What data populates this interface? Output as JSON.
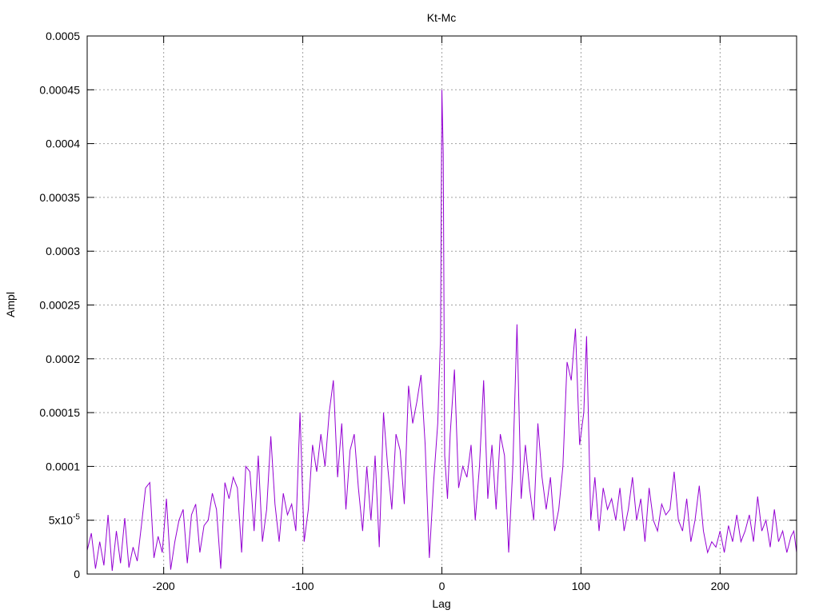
{
  "chart_data": {
    "type": "line",
    "title": "Kt-Mc",
    "xlabel": "Lag",
    "ylabel": "Ampl",
    "xlim": [
      -255,
      255
    ],
    "ylim": [
      0,
      0.0005
    ],
    "grid": true,
    "x_ticks": [
      {
        "value": -200,
        "label": "-200"
      },
      {
        "value": -100,
        "label": "-100"
      },
      {
        "value": 0,
        "label": "0"
      },
      {
        "value": 100,
        "label": "100"
      },
      {
        "value": 200,
        "label": "200"
      }
    ],
    "y_ticks": [
      {
        "value": 0,
        "label": "0"
      },
      {
        "value": 5e-05,
        "label": "5x10",
        "sup": "-5"
      },
      {
        "value": 0.0001,
        "label": "0.0001"
      },
      {
        "value": 0.00015,
        "label": "0.00015"
      },
      {
        "value": 0.0002,
        "label": "0.0002"
      },
      {
        "value": 0.00025,
        "label": "0.00025"
      },
      {
        "value": 0.0003,
        "label": "0.0003"
      },
      {
        "value": 0.00035,
        "label": "0.00035"
      },
      {
        "value": 0.0004,
        "label": "0.0004"
      },
      {
        "value": 0.00045,
        "label": "0.00045"
      },
      {
        "value": 0.0005,
        "label": "0.0005"
      }
    ],
    "series": [
      {
        "color": "#9400d3",
        "points": [
          [
            -255,
            2.2e-05
          ],
          [
            -252,
            3.8e-05
          ],
          [
            -249,
            5e-06
          ],
          [
            -246,
            3e-05
          ],
          [
            -243,
            8e-06
          ],
          [
            -240,
            5.5e-05
          ],
          [
            -237,
            3e-06
          ],
          [
            -234,
            4e-05
          ],
          [
            -231,
            1e-05
          ],
          [
            -228,
            5.2e-05
          ],
          [
            -225,
            6e-06
          ],
          [
            -222,
            2.5e-05
          ],
          [
            -219,
            1.2e-05
          ],
          [
            -216,
            4.5e-05
          ],
          [
            -213,
            8e-05
          ],
          [
            -210,
            8.5e-05
          ],
          [
            -207,
            1.5e-05
          ],
          [
            -204,
            3.5e-05
          ],
          [
            -201,
            2e-05
          ],
          [
            -198,
            7e-05
          ],
          [
            -195,
            4e-06
          ],
          [
            -192,
            3e-05
          ],
          [
            -189,
            5e-05
          ],
          [
            -186,
            6e-05
          ],
          [
            -183,
            1e-05
          ],
          [
            -180,
            5.5e-05
          ],
          [
            -177,
            6.5e-05
          ],
          [
            -174,
            2e-05
          ],
          [
            -171,
            4.5e-05
          ],
          [
            -168,
            5e-05
          ],
          [
            -165,
            7.5e-05
          ],
          [
            -162,
            6e-05
          ],
          [
            -159,
            5e-06
          ],
          [
            -156,
            8.5e-05
          ],
          [
            -153,
            7e-05
          ],
          [
            -150,
            9e-05
          ],
          [
            -147,
            8e-05
          ],
          [
            -144,
            2e-05
          ],
          [
            -141,
            0.0001
          ],
          [
            -138,
            9.5e-05
          ],
          [
            -135,
            4e-05
          ],
          [
            -132,
            0.00011
          ],
          [
            -129,
            3e-05
          ],
          [
            -126,
            6e-05
          ],
          [
            -123,
            0.000128
          ],
          [
            -120,
            6.5e-05
          ],
          [
            -117,
            3e-05
          ],
          [
            -114,
            7.5e-05
          ],
          [
            -111,
            5.5e-05
          ],
          [
            -108,
            6.5e-05
          ],
          [
            -105,
            4e-05
          ],
          [
            -102,
            0.00015
          ],
          [
            -99,
            3e-05
          ],
          [
            -96,
            6e-05
          ],
          [
            -93,
            0.00012
          ],
          [
            -90,
            9.5e-05
          ],
          [
            -87,
            0.00013
          ],
          [
            -84,
            0.0001
          ],
          [
            -81,
            0.00015
          ],
          [
            -78,
            0.00018
          ],
          [
            -75,
            9e-05
          ],
          [
            -72,
            0.00014
          ],
          [
            -69,
            6e-05
          ],
          [
            -66,
            0.000115
          ],
          [
            -63,
            0.00013
          ],
          [
            -60,
            8e-05
          ],
          [
            -57,
            4e-05
          ],
          [
            -54,
            0.0001
          ],
          [
            -51,
            5e-05
          ],
          [
            -48,
            0.00011
          ],
          [
            -45,
            2.5e-05
          ],
          [
            -42,
            0.00015
          ],
          [
            -39,
            0.0001
          ],
          [
            -36,
            6e-05
          ],
          [
            -33,
            0.00013
          ],
          [
            -30,
            0.000115
          ],
          [
            -27,
            6.5e-05
          ],
          [
            -24,
            0.000175
          ],
          [
            -21,
            0.00014
          ],
          [
            -18,
            0.00016
          ],
          [
            -15,
            0.000185
          ],
          [
            -12,
            0.00012
          ],
          [
            -9,
            1.5e-05
          ],
          [
            -6,
            8.5e-05
          ],
          [
            -3,
            0.00014
          ],
          [
            -1,
            0.00022
          ],
          [
            0,
            0.00045
          ],
          [
            1,
            0.00039
          ],
          [
            2,
            0.00011
          ],
          [
            4,
            7e-05
          ],
          [
            6,
            0.00013
          ],
          [
            9,
            0.00019
          ],
          [
            12,
            8e-05
          ],
          [
            15,
            0.0001
          ],
          [
            18,
            9e-05
          ],
          [
            21,
            0.00012
          ],
          [
            24,
            5e-05
          ],
          [
            27,
            0.0001
          ],
          [
            30,
            0.00018
          ],
          [
            33,
            7e-05
          ],
          [
            36,
            0.00012
          ],
          [
            39,
            6e-05
          ],
          [
            42,
            0.00013
          ],
          [
            45,
            0.00011
          ],
          [
            48,
            2e-05
          ],
          [
            51,
            0.0001
          ],
          [
            54,
            0.000232
          ],
          [
            57,
            7e-05
          ],
          [
            60,
            0.00012
          ],
          [
            63,
            8e-05
          ],
          [
            66,
            5e-05
          ],
          [
            69,
            0.00014
          ],
          [
            72,
            9e-05
          ],
          [
            75,
            6e-05
          ],
          [
            78,
            9e-05
          ],
          [
            81,
            4e-05
          ],
          [
            84,
            6e-05
          ],
          [
            87,
            0.0001
          ],
          [
            90,
            0.000197
          ],
          [
            93,
            0.00018
          ],
          [
            96,
            0.000228
          ],
          [
            99,
            0.00012
          ],
          [
            102,
            0.00015
          ],
          [
            104,
            0.000221
          ],
          [
            107,
            5e-05
          ],
          [
            110,
            9e-05
          ],
          [
            113,
            4e-05
          ],
          [
            116,
            8e-05
          ],
          [
            119,
            6e-05
          ],
          [
            122,
            7e-05
          ],
          [
            125,
            5e-05
          ],
          [
            128,
            8e-05
          ],
          [
            131,
            4e-05
          ],
          [
            134,
            6e-05
          ],
          [
            137,
            9e-05
          ],
          [
            140,
            5e-05
          ],
          [
            143,
            7e-05
          ],
          [
            146,
            3e-05
          ],
          [
            149,
            8e-05
          ],
          [
            152,
            5e-05
          ],
          [
            155,
            4e-05
          ],
          [
            158,
            6.5e-05
          ],
          [
            161,
            5.5e-05
          ],
          [
            164,
            6e-05
          ],
          [
            167,
            9.5e-05
          ],
          [
            170,
            5e-05
          ],
          [
            173,
            4e-05
          ],
          [
            176,
            7e-05
          ],
          [
            179,
            3e-05
          ],
          [
            182,
            5e-05
          ],
          [
            185,
            8.2e-05
          ],
          [
            188,
            4e-05
          ],
          [
            191,
            2e-05
          ],
          [
            194,
            3e-05
          ],
          [
            197,
            2.5e-05
          ],
          [
            200,
            4e-05
          ],
          [
            203,
            2e-05
          ],
          [
            206,
            4.5e-05
          ],
          [
            209,
            3e-05
          ],
          [
            212,
            5.5e-05
          ],
          [
            215,
            3e-05
          ],
          [
            218,
            4e-05
          ],
          [
            221,
            5.5e-05
          ],
          [
            224,
            3e-05
          ],
          [
            227,
            7.2e-05
          ],
          [
            230,
            4e-05
          ],
          [
            233,
            5e-05
          ],
          [
            236,
            2.5e-05
          ],
          [
            239,
            6e-05
          ],
          [
            242,
            3e-05
          ],
          [
            245,
            4e-05
          ],
          [
            248,
            2e-05
          ],
          [
            251,
            3.5e-05
          ],
          [
            253,
            4e-05
          ],
          [
            255,
            2e-05
          ]
        ]
      }
    ]
  }
}
